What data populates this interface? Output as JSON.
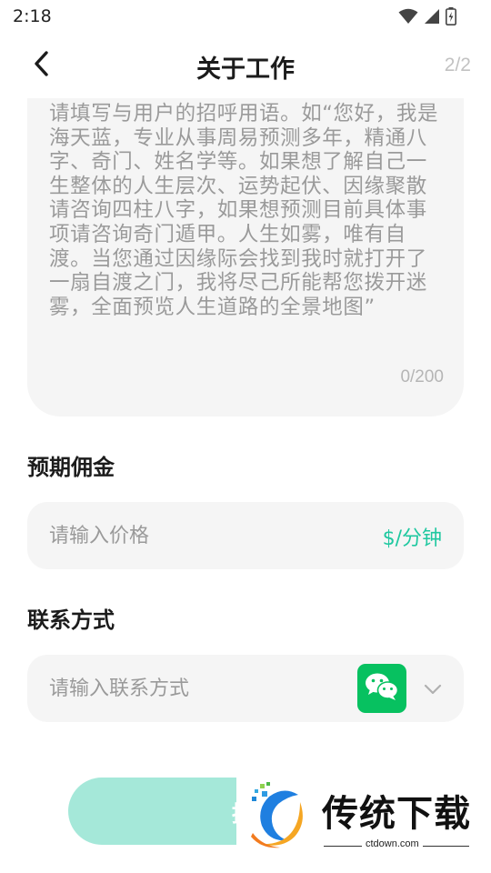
{
  "status_bar": {
    "time": "2:18",
    "icons": [
      "wifi-icon",
      "signal-icon",
      "battery-charging-icon"
    ]
  },
  "header": {
    "title": "关于工作",
    "page_indicator": "2/2",
    "back_icon": "chevron-left-icon"
  },
  "about": {
    "placeholder": "请填写与用户的招呼用语。如“您好，我是海天蓝，专业从事周易预测多年，精通八字、奇门、姓名学等。如果想了解自己一生整体的人生层次、运势起伏、因缘聚散请咨询四柱八字，如果想预测目前具体事项请咨询奇门遁甲。人生如雾，唯有自渡。当您通过因缘际会找到我时就打开了一扇自渡之门，我将尽己所能帮您拨开迷雾，全面预览人生道路的全景地图”",
    "value": "",
    "counter": "0/200"
  },
  "commission": {
    "label": "预期佣金",
    "placeholder": "请输入价格",
    "value": "",
    "unit": "$/分钟"
  },
  "contact": {
    "label": "联系方式",
    "placeholder": "请输入联系方式",
    "value": "",
    "method_icon": "wechat-icon",
    "dropdown_icon": "chevron-down-icon"
  },
  "submit": {
    "label": "提"
  },
  "watermark": {
    "brand": "传统下载",
    "url": "ctdown.com"
  },
  "colors": {
    "accent": "#1fc8a0",
    "submit_bg": "#a5e8d9",
    "wechat": "#07c160",
    "field_bg": "#f5f5f5",
    "placeholder": "#9a9a9a"
  }
}
